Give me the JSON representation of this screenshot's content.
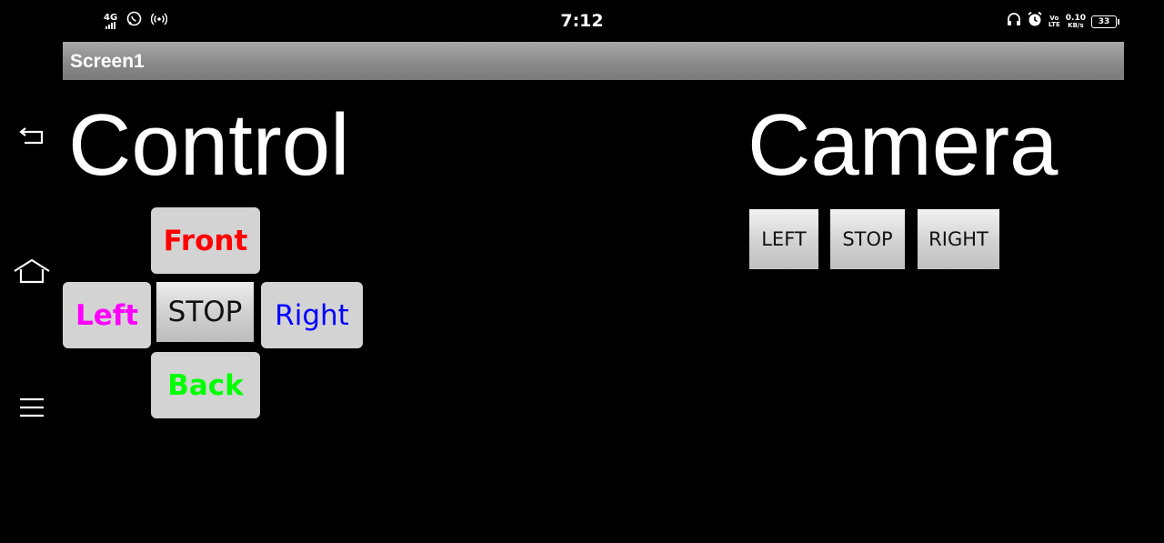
{
  "status_bar": {
    "network": "4G",
    "time": "7:12",
    "volte_top": "Vo",
    "volte_bottom": "LTE",
    "speed_value": "0.10",
    "speed_unit": "KB/s",
    "battery": "33"
  },
  "title_bar": {
    "title": "Screen1"
  },
  "control": {
    "heading": "Control",
    "front": {
      "label": "Front",
      "color": "#ff0000"
    },
    "left": {
      "label": "Left",
      "color": "#ff00ff"
    },
    "stop": {
      "label": "STOP",
      "color": "#111111"
    },
    "right": {
      "label": "Right",
      "color": "#0000ff"
    },
    "back": {
      "label": "Back",
      "color": "#00ff00"
    }
  },
  "camera": {
    "heading": "Camera",
    "left_label": "LEFT",
    "stop_label": "STOP",
    "right_label": "RIGHT"
  }
}
